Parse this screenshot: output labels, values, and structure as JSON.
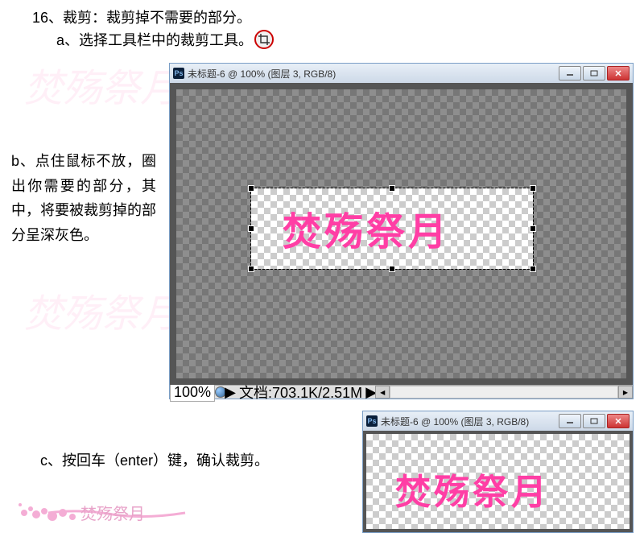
{
  "doc": {
    "heading": "16、裁剪：裁剪掉不需要的部分。",
    "step_a": "a、选择工具栏中的裁剪工具。",
    "step_b": "b、点住鼠标不放，圈出你需要的部分，其中，将要被裁剪掉的部分呈深灰色。",
    "step_c": "c、按回车（enter）键，确认裁剪。"
  },
  "icons": {
    "crop": "crop"
  },
  "window1": {
    "ps_label": "Ps",
    "title": "未标题-6 @ 100% (图层 3, RGB/8)",
    "zoom": "100%",
    "doc_info": "文档:703.1K/2.51M",
    "canvas_text": "焚殇祭月"
  },
  "window2": {
    "ps_label": "Ps",
    "title": "未标题-6 @ 100% (图层 3, RGB/8)",
    "canvas_text": "焚殇祭月"
  },
  "watermark_text": "焚殇祭月"
}
